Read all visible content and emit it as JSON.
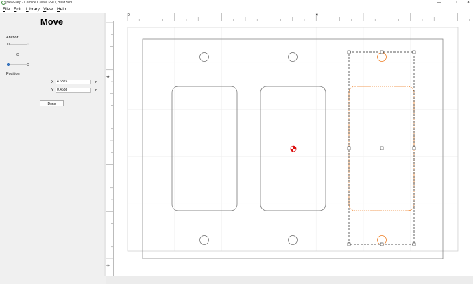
{
  "window": {
    "title": "[NewFile]* - Carbide Create PRO, Build 509"
  },
  "menu": [
    "File",
    "Edit",
    "Library",
    "View",
    "Help"
  ],
  "menu_accel": [
    "F",
    "E",
    "L",
    "V",
    "H"
  ],
  "panel": {
    "title": "Move",
    "anchor_label": "Anchor",
    "position_label": "Position",
    "x": {
      "label": "X",
      "value": "4.6875",
      "unit": "in"
    },
    "y": {
      "label": "Y",
      "value": "0.4688",
      "unit": "in"
    },
    "done_label": "Done",
    "selected_anchor": "bottom-left"
  },
  "ruler": {
    "top": [
      "0",
      "4"
    ],
    "left": [
      "4",
      "0"
    ]
  },
  "colors": {
    "selection": "#ee7d22",
    "geometry": "#555555",
    "origin": "#dd1111"
  },
  "icons": {
    "app": "carbide-logo-icon",
    "minimize": "minimize-icon",
    "maximize": "maximize-icon",
    "close": "close-icon"
  }
}
